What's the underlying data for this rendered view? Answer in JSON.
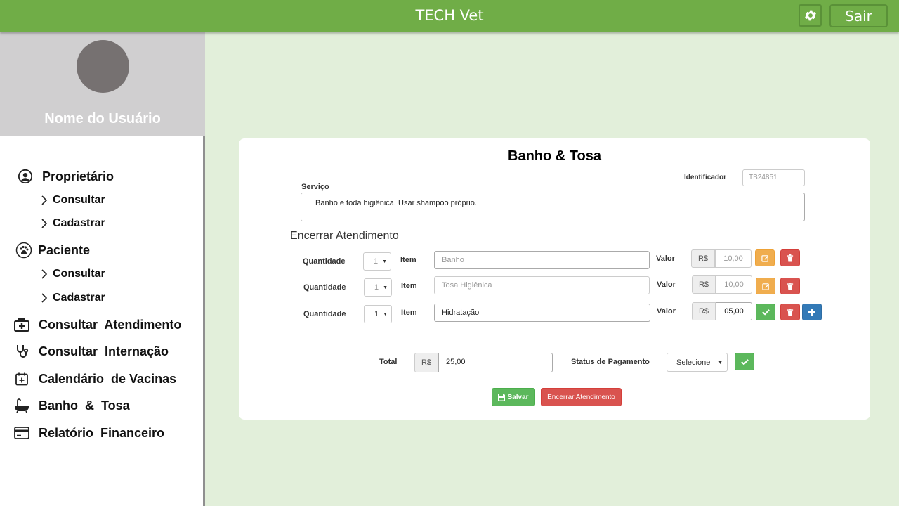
{
  "header": {
    "title": "TECH Vet",
    "logout_label": "Sair"
  },
  "sidebar": {
    "user_name": "Nome do Usuário",
    "owner": {
      "label": "Proprietário",
      "sub": [
        "Consultar",
        "Cadastrar"
      ]
    },
    "patient": {
      "label": "Paciente",
      "sub": [
        "Consultar",
        "Cadastrar"
      ]
    },
    "items": [
      "Consultar  Atendimento",
      "Consultar  Internação",
      "Calendário  de Vacinas",
      "Banho  &  Tosa",
      "Relatório  Financeiro"
    ]
  },
  "form": {
    "title": "Banho & Tosa",
    "identifier_label": "Identificador",
    "identifier_value": "TB24851",
    "service_label": "Serviço",
    "service_text": "Banho e toda higiênica. Usar shampoo próprio.",
    "section_title": "Encerrar Atendimento",
    "rows": [
      {
        "qty_label": "Quantidade",
        "qty": "1",
        "item_label": "Item",
        "item": "Banho",
        "valor_label": "Valor",
        "currency": "R$",
        "valor": "10,00"
      },
      {
        "qty_label": "Quantidade",
        "qty": "1",
        "item_label": "Item",
        "item": "Tosa Higiênica",
        "valor_label": "Valor",
        "currency": "R$",
        "valor": "10,00"
      },
      {
        "qty_label": "Quantidade",
        "qty": "1",
        "item_label": "Item",
        "item": "Hidratação",
        "valor_label": "Valor",
        "currency": "R$",
        "valor": "05,00"
      }
    ],
    "total_label": "Total",
    "total_currency": "R$",
    "total_value": "25,00",
    "status_label": "Status de Pagamento",
    "status_value": "Selecione",
    "save_label": "Salvar",
    "close_label": "Encerrar Atendimento"
  },
  "colors": {
    "header": "#70ad47",
    "background": "#e2efda",
    "success": "#5cb85c",
    "danger": "#d9534f",
    "warning": "#f0ad4e",
    "primary": "#337ab7"
  },
  "icons": [
    "gear-icon",
    "user-circle-icon",
    "paw-icon",
    "medical-kit-icon",
    "stethoscope-icon",
    "calendar-plus-icon",
    "bathtub-icon",
    "credit-card-icon",
    "chevron-right-icon",
    "edit-icon",
    "trash-icon",
    "check-icon",
    "plus-icon",
    "floppy-icon"
  ]
}
